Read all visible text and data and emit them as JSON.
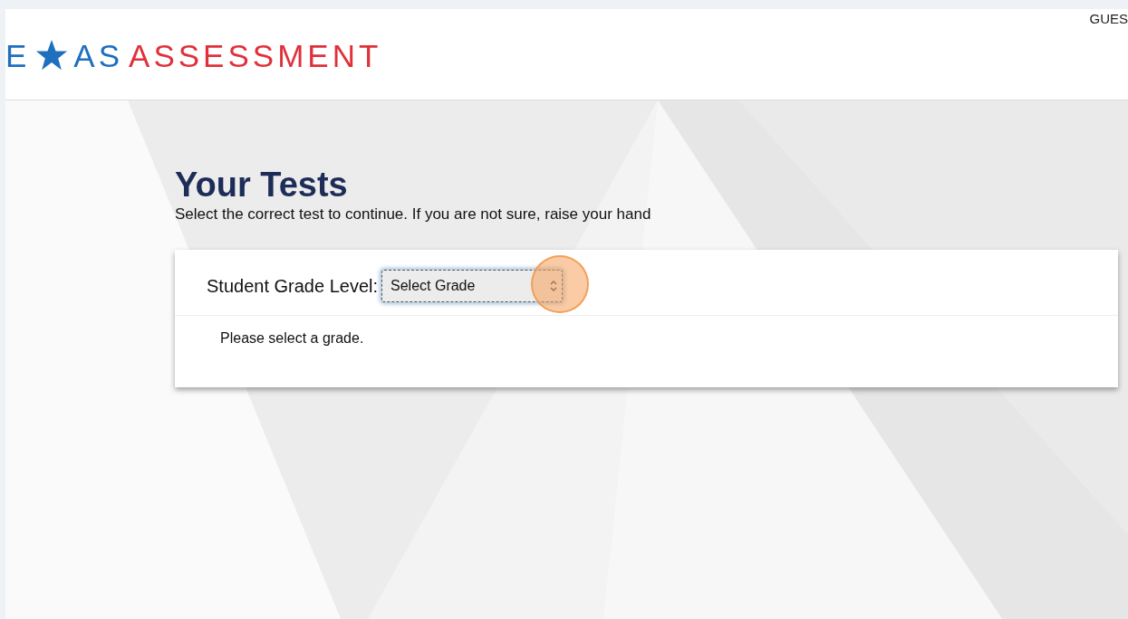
{
  "header": {
    "logo": {
      "part_1": "E",
      "part_2": "AS",
      "part_3": "ASSESSMENT"
    },
    "user": "GUES"
  },
  "page": {
    "title": "Your Tests",
    "subtitle": "Select the correct test to continue. If you are not sure, raise your hand"
  },
  "form": {
    "label": "Student Grade Level:",
    "select": {
      "value": "Select Grade",
      "focused": true
    },
    "message": "Please select a grade."
  }
}
